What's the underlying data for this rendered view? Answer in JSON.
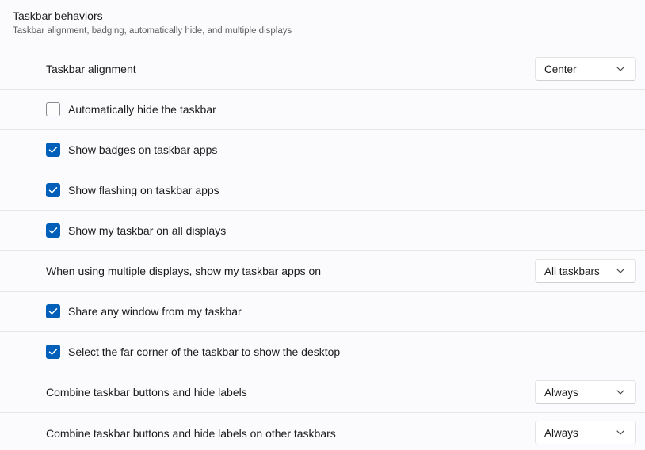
{
  "section": {
    "title": "Taskbar behaviors",
    "subtitle": "Taskbar alignment, badging, automatically hide, and multiple displays"
  },
  "rows": [
    {
      "type": "dropdown",
      "label": "Taskbar alignment",
      "value": "Center"
    },
    {
      "type": "checkbox",
      "label": "Automatically hide the taskbar",
      "checked": false
    },
    {
      "type": "checkbox",
      "label": "Show badges on taskbar apps",
      "checked": true
    },
    {
      "type": "checkbox",
      "label": "Show flashing on taskbar apps",
      "checked": true
    },
    {
      "type": "checkbox",
      "label": "Show my taskbar on all displays",
      "checked": true
    },
    {
      "type": "dropdown",
      "label": "When using multiple displays, show my taskbar apps on",
      "value": "All taskbars"
    },
    {
      "type": "checkbox",
      "label": "Share any window from my taskbar",
      "checked": true
    },
    {
      "type": "checkbox",
      "label": "Select the far corner of the taskbar to show the desktop",
      "checked": true
    },
    {
      "type": "dropdown",
      "label": "Combine taskbar buttons and hide labels",
      "value": "Always"
    },
    {
      "type": "dropdown",
      "label": "Combine taskbar buttons and hide labels on other taskbars",
      "value": "Always"
    }
  ],
  "colors": {
    "accent": "#005fb8",
    "background": "#fbfbfd",
    "divider": "#e6e6e6"
  },
  "icons": {
    "check": "checkmark-icon",
    "dropdown": "chevron-down-icon"
  }
}
